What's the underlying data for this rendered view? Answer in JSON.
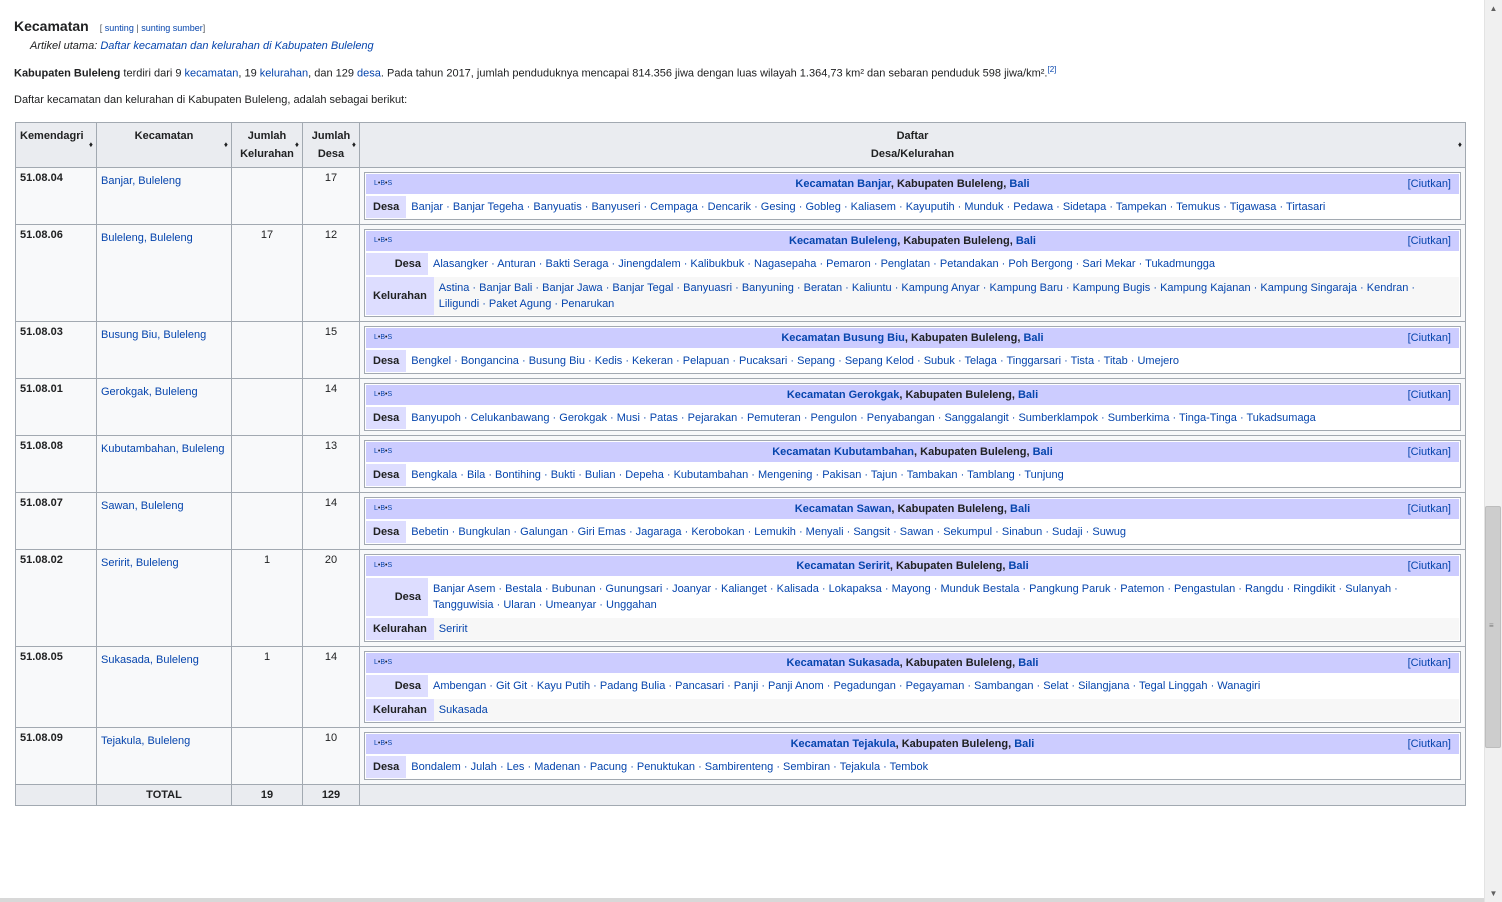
{
  "section": {
    "title": "Kecamatan",
    "edit_open": "[",
    "edit": "sunting",
    "edit_sep": "|",
    "edit_source": "sunting sumber",
    "edit_close": "]"
  },
  "hatnote": {
    "prefix": "Artikel utama:",
    "link": "Daftar kecamatan dan kelurahan di Kabupaten Buleleng"
  },
  "intro": {
    "bold": "Kabupaten Buleleng",
    "t1": " terdiri dari 9 ",
    "l1": "kecamatan",
    "t2": ", 19 ",
    "l2": "kelurahan",
    "t3": ", dan 129 ",
    "l3": "desa",
    "t4": ". Pada tahun 2017, jumlah penduduknya mencapai 814.356 jiwa dengan luas wilayah 1.364,73 km² dan sebaran penduduk 598 jiwa/km².",
    "ref": "[2]"
  },
  "list_intro": "Daftar kecamatan dan kelurahan di Kabupaten Buleleng, adalah sebagai berikut:",
  "table": {
    "headers": {
      "kode": "Kemendagri",
      "kecamatan": "Kecamatan",
      "kel1": "Jumlah",
      "kel2": "Kelurahan",
      "desa1": "Jumlah",
      "desa2": "Desa",
      "daftar1": "Daftar",
      "daftar2": "Desa/Kelurahan"
    },
    "sort_icon": "sort-icon",
    "navbox": {
      "v": "L",
      "b": "B",
      "s": "S",
      "dot": "•",
      "prefix": "Kecamatan",
      "kab": "Kabupaten Buleleng",
      "comma": ", ",
      "prov": "Bali",
      "hide": "[Ciutkan]",
      "desa_label": "Desa",
      "kel_label": "Kelurahan"
    },
    "rows": [
      {
        "kode": "51.08.04",
        "kecamatan": "Banjar, Buleleng",
        "kelurahan": "",
        "desa": "17",
        "nav_name": "Banjar",
        "desa_list": "Banjar · Banjar Tegeha · Banyuatis · Banyuseri · Cempaga · Dencarik · Gesing · Gobleg · Kaliasem · Kayuputih · Munduk · Pedawa · Sidetapa · Tampekan · Temukus · Tigawasa · Tirtasari",
        "kel_list": ""
      },
      {
        "kode": "51.08.06",
        "kecamatan": "Buleleng, Buleleng",
        "kelurahan": "17",
        "desa": "12",
        "nav_name": "Buleleng",
        "desa_list": "Alasangker · Anturan · Bakti Seraga · Jinengdalem · Kalibukbuk · Nagasepaha · Pemaron · Penglatan · Petandakan · Poh Bergong · Sari Mekar · Tukadmungga",
        "kel_list": "Astina · Banjar Bali · Banjar Jawa · Banjar Tegal · Banyuasri · Banyuning · Beratan · Kaliuntu · Kampung Anyar · Kampung Baru · Kampung Bugis · Kampung Kajanan · Kampung Singaraja · Kendran · Liligundi · Paket Agung · Penarukan"
      },
      {
        "kode": "51.08.03",
        "kecamatan": "Busung Biu, Buleleng",
        "kelurahan": "",
        "desa": "15",
        "nav_name": "Busung Biu",
        "desa_list": "Bengkel · Bongancina · Busung Biu · Kedis · Kekeran · Pelapuan · Pucaksari · Sepang · Sepang Kelod · Subuk · Telaga · Tinggarsari · Tista · Titab · Umejero",
        "kel_list": ""
      },
      {
        "kode": "51.08.01",
        "kecamatan": "Gerokgak, Buleleng",
        "kelurahan": "",
        "desa": "14",
        "nav_name": "Gerokgak",
        "desa_list": "Banyupoh · Celukanbawang · Gerokgak · Musi · Patas · Pejarakan · Pemuteran · Pengulon · Penyabangan · Sanggalangit · Sumberklampok · Sumberkima · Tinga-Tinga · Tukadsumaga",
        "kel_list": ""
      },
      {
        "kode": "51.08.08",
        "kecamatan": "Kubutambahan, Buleleng",
        "kelurahan": "",
        "desa": "13",
        "nav_name": "Kubutambahan",
        "desa_list": "Bengkala · Bila · Bontihing · Bukti · Bulian · Depeha · Kubutambahan · Mengening · Pakisan · Tajun · Tambakan · Tamblang · Tunjung",
        "kel_list": ""
      },
      {
        "kode": "51.08.07",
        "kecamatan": "Sawan, Buleleng",
        "kelurahan": "",
        "desa": "14",
        "nav_name": "Sawan",
        "desa_list": "Bebetin · Bungkulan · Galungan · Giri Emas · Jagaraga · Kerobokan · Lemukih · Menyali · Sangsit · Sawan · Sekumpul · Sinabun · Sudaji · Suwug",
        "kel_list": ""
      },
      {
        "kode": "51.08.02",
        "kecamatan": "Seririt, Buleleng",
        "kelurahan": "1",
        "desa": "20",
        "nav_name": "Seririt",
        "desa_list": "Banjar Asem · Bestala · Bubunan · Gunungsari · Joanyar · Kalianget · Kalisada · Lokapaksa · Mayong · Munduk Bestala · Pangkung Paruk · Patemon · Pengastulan · Rangdu · Ringdikit · Sulanyah · Tangguwisia · Ularan · Umeanyar · Unggahan",
        "kel_list": "Seririt"
      },
      {
        "kode": "51.08.05",
        "kecamatan": "Sukasada, Buleleng",
        "kelurahan": "1",
        "desa": "14",
        "nav_name": "Sukasada",
        "desa_list": "Ambengan · Git Git · Kayu Putih · Padang Bulia · Pancasari · Panji · Panji Anom · Pegadungan · Pegayaman · Sambangan · Selat · Silangjana · Tegal Linggah · Wanagiri",
        "kel_list": "Sukasada"
      },
      {
        "kode": "51.08.09",
        "kecamatan": "Tejakula, Buleleng",
        "kelurahan": "",
        "desa": "10",
        "nav_name": "Tejakula",
        "desa_list": "Bondalem · Julah · Les · Madenan · Pacung · Penuktukan · Sambirenteng · Sembiran · Tejakula · Tembok",
        "kel_list": ""
      }
    ],
    "total": {
      "label": "TOTAL",
      "kelurahan": "19",
      "desa": "129"
    }
  },
  "scrollbar": {
    "up_icon": "▲",
    "down_icon": "▼",
    "grip": "≡"
  }
}
